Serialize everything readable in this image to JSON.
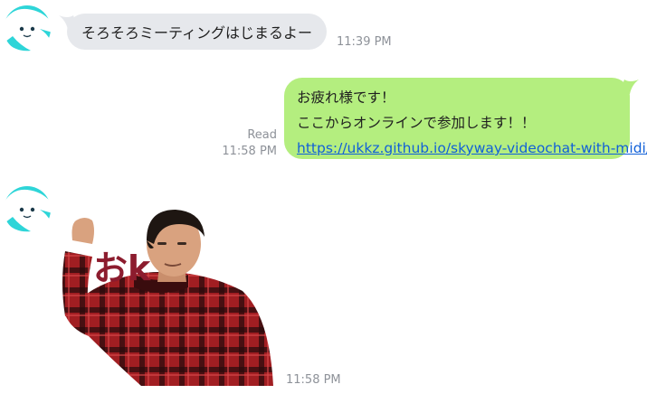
{
  "messages": [
    {
      "sender": "other",
      "text": "そろそろミーティングはじまるよー",
      "time": "11:39 PM"
    },
    {
      "sender": "me",
      "lines": [
        "お疲れ様です！",
        "ここからオンラインで参加します！！"
      ],
      "link": "https://ukkz.github.io/skyway-videochat-with-midi/",
      "read_label": "Read",
      "time": "11:58 PM"
    },
    {
      "sender": "other",
      "sticker_text": "おk",
      "time": "11:58 PM"
    }
  ],
  "colors": {
    "incoming_bubble": "#e6e8ec",
    "outgoing_bubble": "#b4ee7f",
    "link": "#1160d8",
    "avatar": "#2ed5d8",
    "sticker_text": "#8c1c2e"
  }
}
